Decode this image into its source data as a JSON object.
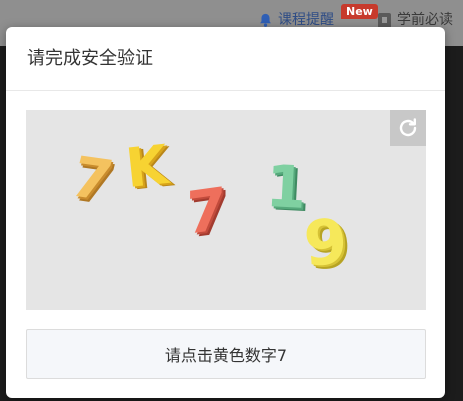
{
  "topbar": {
    "course_label": "课程提醒",
    "badge_label": "New",
    "study_label": "学前必读"
  },
  "modal": {
    "title": "请完成安全验证",
    "refresh_icon": "refresh-icon",
    "captcha": {
      "glyphs": [
        {
          "char": "7",
          "color": "#f4c25f"
        },
        {
          "char": "K",
          "color": "#f7d332"
        },
        {
          "char": "7",
          "color": "#ee6f5c"
        },
        {
          "char": "1",
          "color": "#7fd0a1"
        },
        {
          "char": "9",
          "color": "#f6e85a"
        }
      ]
    },
    "prompt": "请点击黄色数字7"
  },
  "colors": {
    "overlay": "#1c1c1c",
    "topbar": "#8f8f8f",
    "link": "#2f4d86",
    "badge": "#c73a2c",
    "captcha_bg": "#e5e5e5"
  }
}
